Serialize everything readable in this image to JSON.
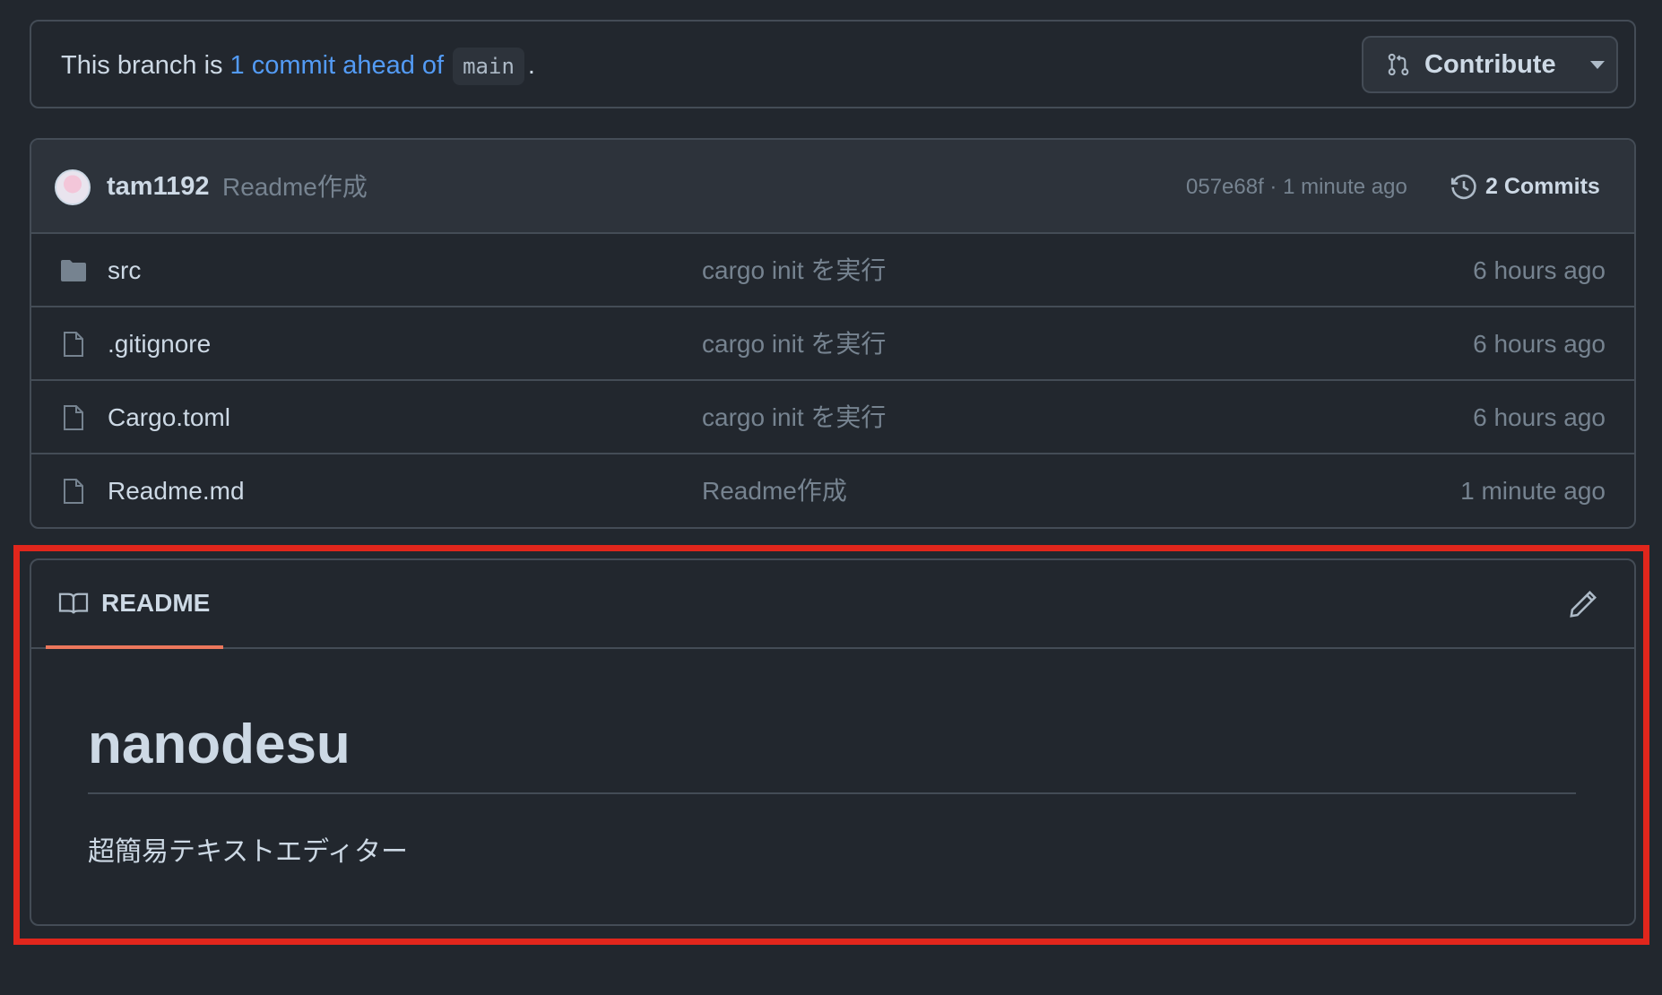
{
  "banner": {
    "prefix": "This branch is",
    "link_text": "1 commit ahead of",
    "branch": "main",
    "suffix": ".",
    "contribute_label": "Contribute"
  },
  "latest_commit": {
    "author": "tam1192",
    "message": "Readme作成",
    "meta": "057e68f · 1 minute ago",
    "commits_label": "2 Commits"
  },
  "files": [
    {
      "name": "src",
      "icon": "folder-icon",
      "message": "cargo init を実行",
      "time": "6 hours ago"
    },
    {
      "name": ".gitignore",
      "icon": "file-icon",
      "message": "cargo init を実行",
      "time": "6 hours ago"
    },
    {
      "name": "Cargo.toml",
      "icon": "file-icon",
      "message": "cargo init を実行",
      "time": "6 hours ago"
    },
    {
      "name": "Readme.md",
      "icon": "file-icon",
      "message": "Readme作成",
      "time": "1 minute ago"
    }
  ],
  "readme": {
    "tab_label": "README",
    "title": "nanodesu",
    "body": "超簡易テキストエディター"
  },
  "colors": {
    "background": "#22272e",
    "link": "#539bf5",
    "highlight": "#e1261c",
    "tab_underline": "#ec775c"
  }
}
